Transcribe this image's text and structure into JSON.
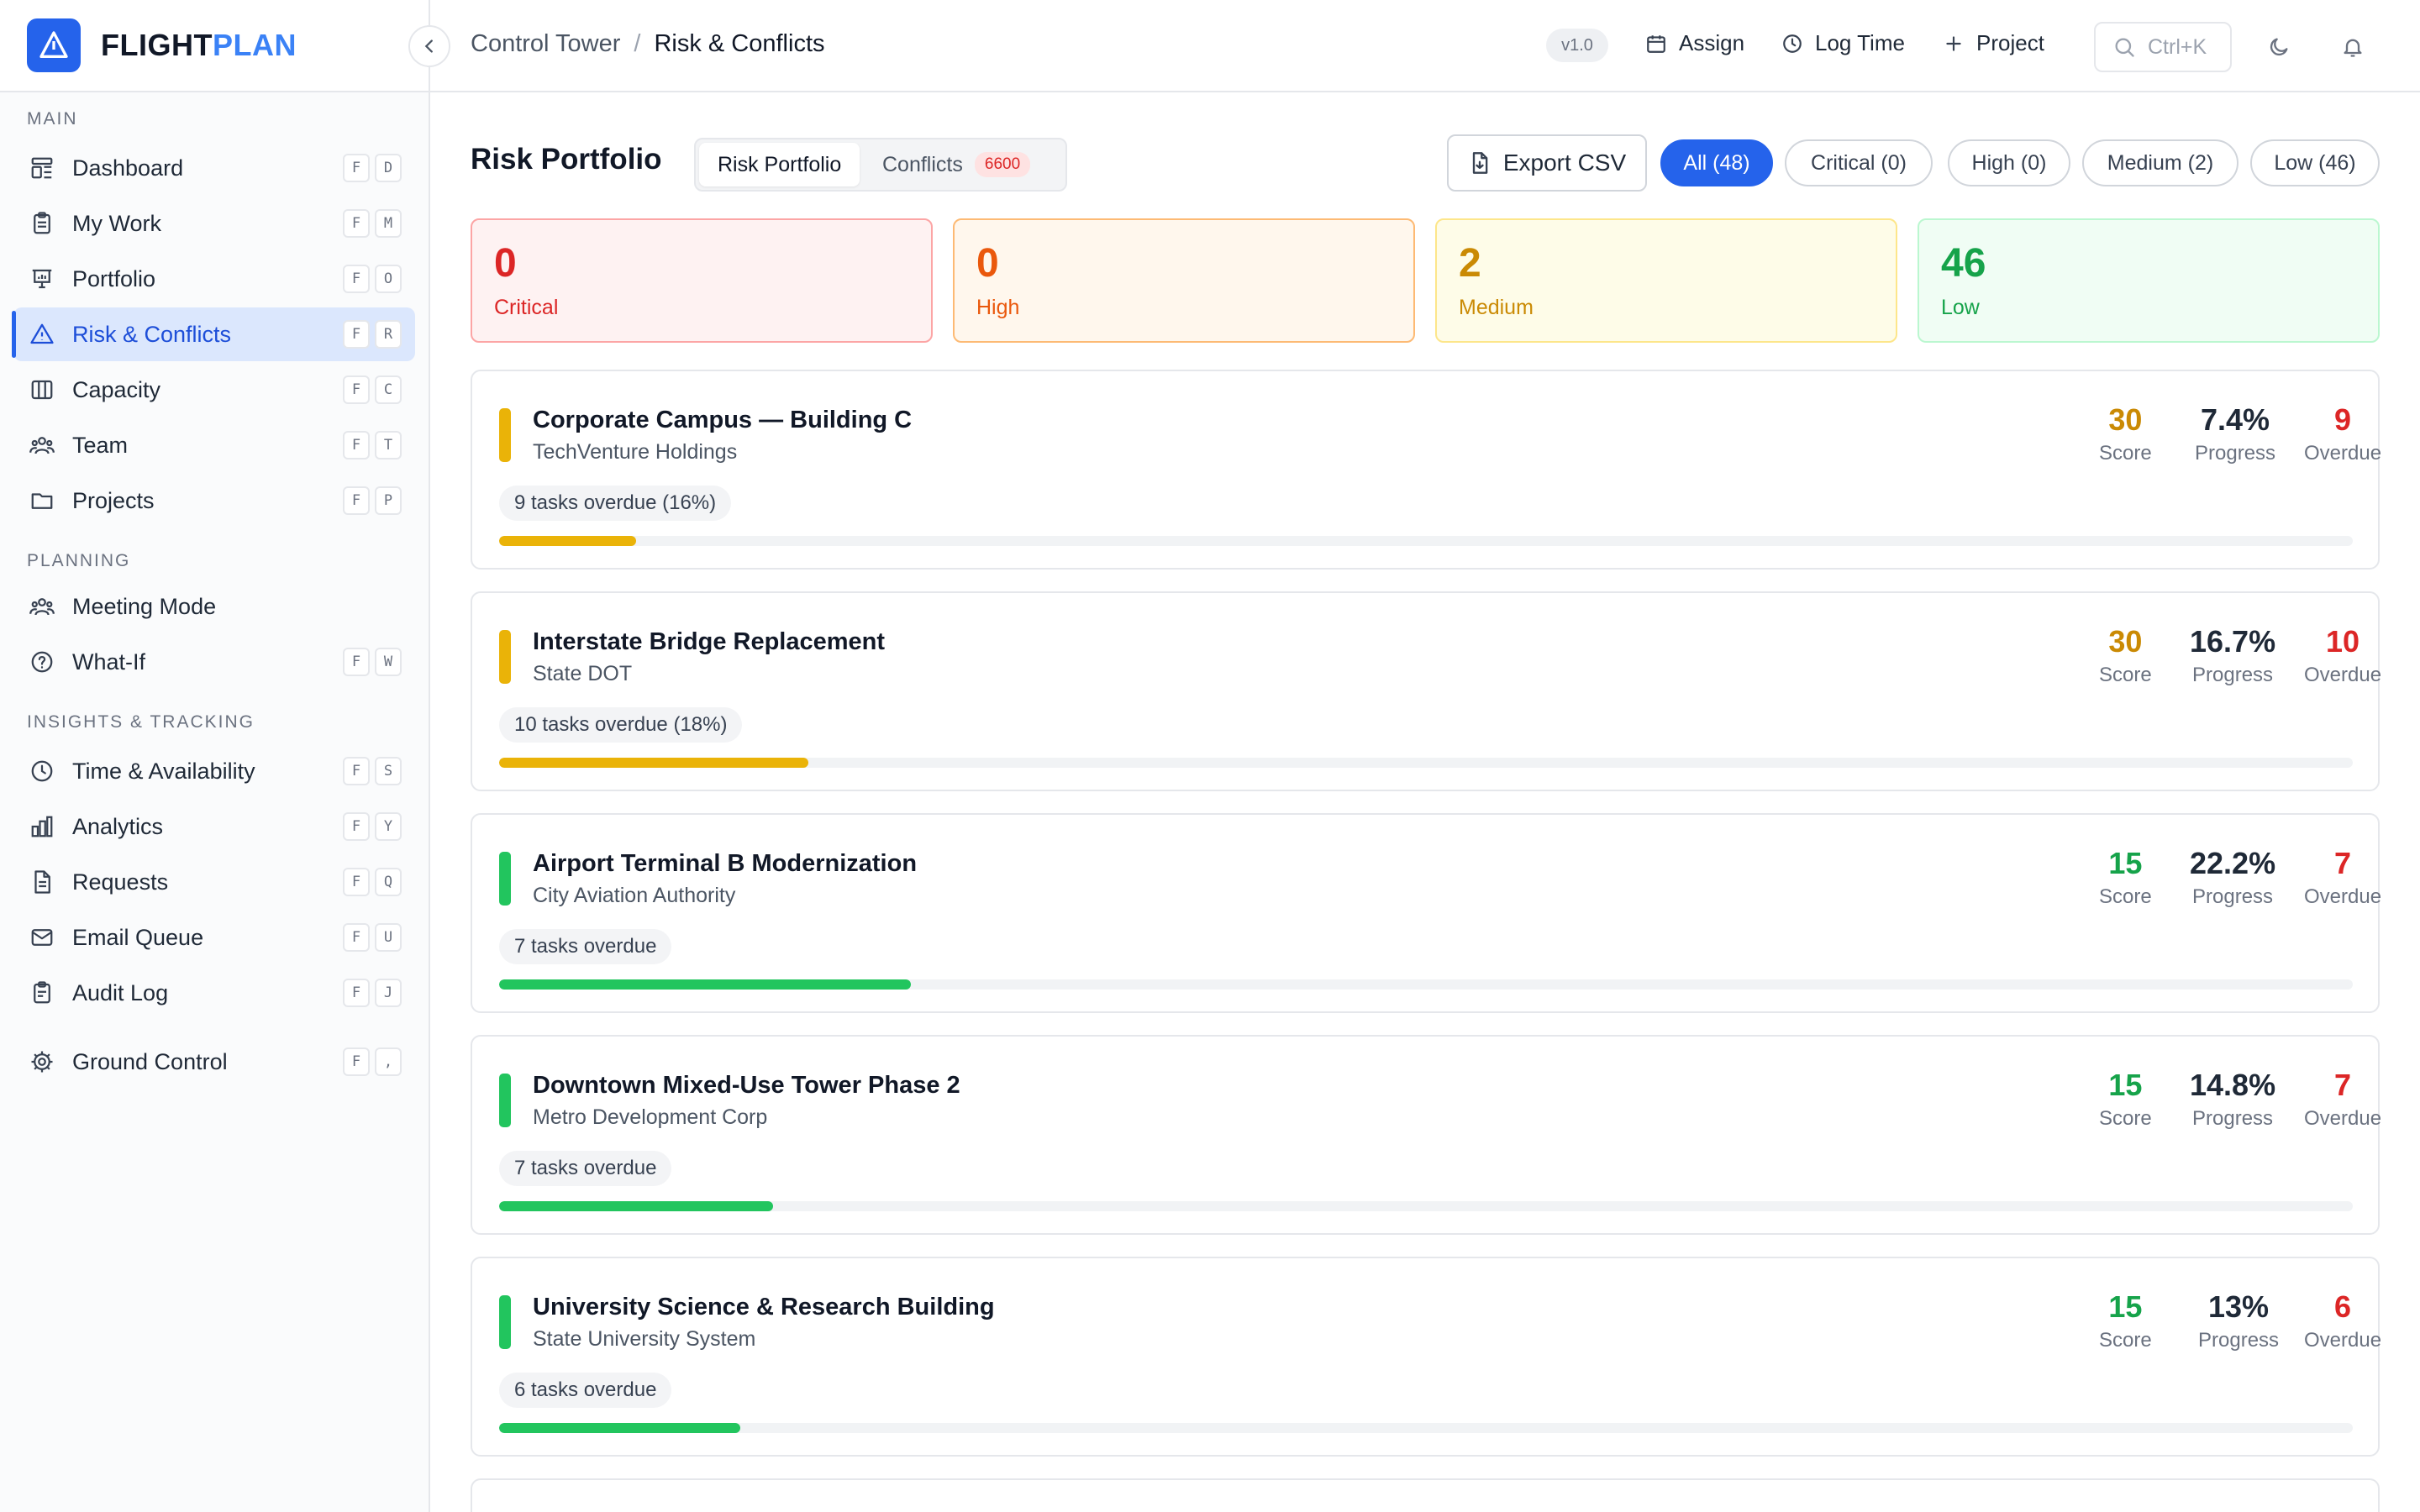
{
  "brand": {
    "name_main": "FLIGHT",
    "name_accent": "PLAN"
  },
  "sidebar": {
    "sections": [
      {
        "label": "MAIN"
      },
      {
        "label": "PLANNING"
      },
      {
        "label": "INSIGHTS & TRACKING"
      }
    ],
    "items": [
      {
        "label": "Dashboard",
        "icon": "dashboard-icon",
        "keys": [
          "F",
          "D"
        ]
      },
      {
        "label": "My Work",
        "icon": "clipboard-icon",
        "keys": [
          "F",
          "M"
        ]
      },
      {
        "label": "Portfolio",
        "icon": "presentation-chart-icon",
        "keys": [
          "F",
          "O"
        ]
      },
      {
        "label": "Risk & Conflicts",
        "icon": "warning-triangle-icon",
        "keys": [
          "F",
          "R"
        ],
        "active": true
      },
      {
        "label": "Capacity",
        "icon": "columns-icon",
        "keys": [
          "F",
          "C"
        ]
      },
      {
        "label": "Team",
        "icon": "users-icon",
        "keys": [
          "F",
          "T"
        ]
      },
      {
        "label": "Projects",
        "icon": "folder-icon",
        "keys": [
          "F",
          "P"
        ]
      },
      {
        "label": "Meeting Mode",
        "icon": "users-icon",
        "keys": []
      },
      {
        "label": "What-If",
        "icon": "help-circle-icon",
        "keys": [
          "F",
          "W"
        ]
      },
      {
        "label": "Time & Availability",
        "icon": "clock-icon",
        "keys": [
          "F",
          "S"
        ]
      },
      {
        "label": "Analytics",
        "icon": "bar-chart-icon",
        "keys": [
          "F",
          "Y"
        ]
      },
      {
        "label": "Requests",
        "icon": "document-icon",
        "keys": [
          "F",
          "Q"
        ]
      },
      {
        "label": "Email Queue",
        "icon": "mail-icon",
        "keys": [
          "F",
          "U"
        ]
      },
      {
        "label": "Audit Log",
        "icon": "clipboard-list-icon",
        "keys": [
          "F",
          "J"
        ]
      },
      {
        "label": "Ground Control",
        "icon": "gear-icon",
        "keys": [
          "F",
          ","
        ]
      }
    ]
  },
  "topbar": {
    "breadcrumb_parent": "Control Tower",
    "breadcrumb_sep": "/",
    "breadcrumb_current": "Risk & Conflicts",
    "version": "v1.0",
    "assign_label": "Assign",
    "log_time_label": "Log Time",
    "project_label": "Project",
    "search_placeholder": "Ctrl+K"
  },
  "main": {
    "title": "Risk Portfolio",
    "tabs": [
      {
        "label": "Risk Portfolio"
      },
      {
        "label": "Conflicts",
        "badge": "6600"
      }
    ],
    "export_label": "Export CSV",
    "filters": [
      {
        "label": "All (48)"
      },
      {
        "label": "Critical (0)"
      },
      {
        "label": "High (0)"
      },
      {
        "label": "Medium (2)"
      },
      {
        "label": "Low (46)"
      }
    ],
    "stats": [
      {
        "value": "0",
        "label": "Critical",
        "color": "#dc2626",
        "bg": "#fef2f2",
        "border": "#fca5a5"
      },
      {
        "value": "0",
        "label": "High",
        "color": "#ea580c",
        "bg": "#fff7ed",
        "border": "#fdba74"
      },
      {
        "value": "2",
        "label": "Medium",
        "color": "#ca8a04",
        "bg": "#fefce8",
        "border": "#fde68a"
      },
      {
        "value": "46",
        "label": "Low",
        "color": "#16a34a",
        "bg": "#f0fdf4",
        "border": "#bbf7d0"
      }
    ],
    "metric_labels": {
      "score": "Score",
      "progress": "Progress",
      "overdue": "Overdue"
    },
    "projects": [
      {
        "name": "Corporate Campus — Building C",
        "client": "TechVenture Holdings",
        "score": "30",
        "progress": "7.4%",
        "overdue": "9",
        "overdue_text": "9 tasks overdue (16%)",
        "overdue_fraction": 0.074,
        "color": "#eab308"
      },
      {
        "name": "Interstate Bridge Replacement",
        "client": "State DOT",
        "score": "30",
        "progress": "16.7%",
        "overdue": "10",
        "overdue_text": "10 tasks overdue (18%)",
        "overdue_fraction": 0.167,
        "color": "#eab308"
      },
      {
        "name": "Airport Terminal B Modernization",
        "client": "City Aviation Authority",
        "score": "15",
        "progress": "22.2%",
        "overdue": "7",
        "overdue_text": "7 tasks overdue",
        "overdue_fraction": 0.222,
        "color": "#22c55e"
      },
      {
        "name": "Downtown Mixed-Use Tower Phase 2",
        "client": "Metro Development Corp",
        "score": "15",
        "progress": "14.8%",
        "overdue": "7",
        "overdue_text": "7 tasks overdue",
        "overdue_fraction": 0.148,
        "color": "#22c55e"
      },
      {
        "name": "University Science & Research Building",
        "client": "State University System",
        "score": "15",
        "progress": "13%",
        "overdue": "6",
        "overdue_text": "6 tasks overdue",
        "overdue_fraction": 0.13,
        "color": "#22c55e"
      }
    ],
    "score_colors": {
      "30": "#ca8a04",
      "15": "#16a34a"
    },
    "overdue_color": "#dc2626"
  }
}
